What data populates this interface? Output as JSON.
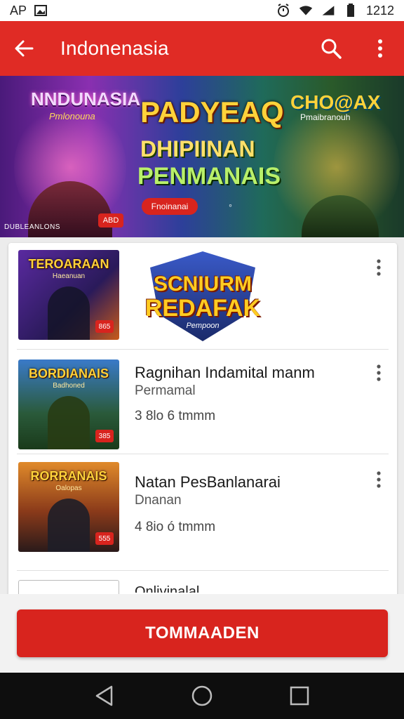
{
  "status_bar": {
    "carrier": "AP",
    "time": "1212"
  },
  "app_bar": {
    "title": "Indonenasia"
  },
  "banner": {
    "left_title": "NNDUNASIA",
    "left_subtitle": "Pmlonouna",
    "center_line1": "PADYEAQ",
    "center_line2": "DHIPIINAN",
    "center_line3": "PENMANAIS",
    "right_title": "CHO@AX",
    "right_subtitle": "Pmaibranouh",
    "pill_label": "Fnoinanai",
    "badge_label": "ABD",
    "small_caption": "DUBLEANLONS"
  },
  "list": {
    "items": [
      {
        "thumb_title": "TEROARAAN",
        "thumb_subtitle": "Haeanuan",
        "thumb_badge": "865",
        "logo_line1": "SCNIURM",
        "logo_line2": "REDAFAK",
        "logo_line3": "Pempoon"
      },
      {
        "thumb_title": "BORDIANAIS",
        "thumb_subtitle": "Badhoned",
        "thumb_badge": "385",
        "title": "Ragnihan Indamital manm",
        "subtitle": "Permamal",
        "meta": "3 8lo 6 tmmm"
      },
      {
        "thumb_title": "RORRANAIS",
        "thumb_subtitle": "Oalopas",
        "thumb_badge": "555",
        "title": "Natan PesBanlanarai",
        "subtitle": "Dnanan",
        "meta": "4 8io ó tmmm"
      }
    ],
    "partial_title": "Onlivinalal"
  },
  "cta": {
    "label": "TOMMAADEN"
  },
  "colors": {
    "primary_red": "#e02b25",
    "button_red": "#d8241e"
  }
}
